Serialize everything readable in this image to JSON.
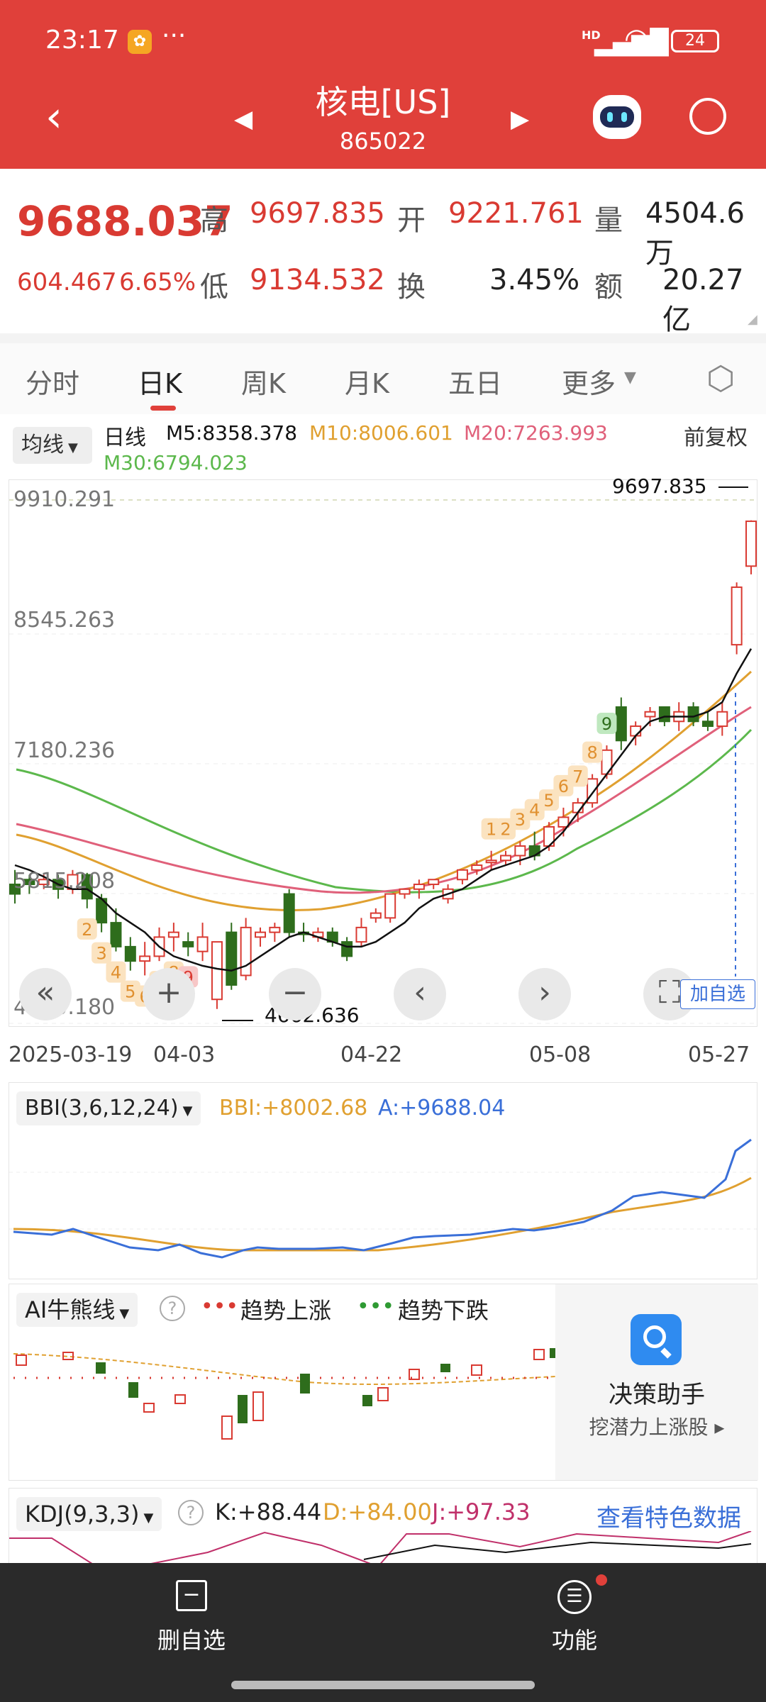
{
  "status_bar": {
    "time": "23:17",
    "battery": "24",
    "network": "HD"
  },
  "header": {
    "title": "核电[US]",
    "code": "865022"
  },
  "quote": {
    "price": "9688.037",
    "change": "604.467",
    "change_pct": "6.65%",
    "high_label": "高",
    "high": "9697.835",
    "open_label": "开",
    "open": "9221.761",
    "volume_label": "量",
    "volume": "4504.6万",
    "low_label": "低",
    "low": "9134.532",
    "turnover_label": "换",
    "turnover": "3.45%",
    "amount_label": "额",
    "amount": "20.27亿"
  },
  "tabs": [
    "分时",
    "日K",
    "周K",
    "月K",
    "五日",
    "更多"
  ],
  "ma_bar": {
    "selector": "均线",
    "period": "日线",
    "m5": "M5:8358.378",
    "m10": "M10:8006.601",
    "m20": "M20:7263.993",
    "m30": "M30:6794.023",
    "adjust": "前复权"
  },
  "main_chart": {
    "y_labels": [
      "9910.291",
      "8545.263",
      "7180.236",
      "5815.208",
      "4450.180"
    ],
    "high_marker": "9697.835",
    "low_marker": "4662.636",
    "x_labels": [
      "2025-03-19",
      "04-03",
      "04-22",
      "05-08",
      "05-27"
    ],
    "add_label": "加自选",
    "td_up_counts": [
      "1",
      "2",
      "3",
      "4",
      "5",
      "6",
      "7",
      "8",
      "9"
    ],
    "td_down_counts": [
      "2",
      "3",
      "4",
      "5",
      "6",
      "7",
      "8",
      "9"
    ]
  },
  "bbi": {
    "label": "BBI(3,6,12,24)",
    "bbi_value": "BBI:+8002.68",
    "a_value": "A:+9688.04"
  },
  "ai": {
    "label": "AI牛熊线",
    "legend_up": "趋势上涨",
    "legend_down": "趋势下跌",
    "assistant_title": "决策助手",
    "assistant_sub": "挖潜力上涨股"
  },
  "kdj": {
    "label": "KDJ(9,3,3)",
    "k": "K:+88.44",
    "d": "D:+84.00",
    "j": "J:+97.33",
    "link": "查看特色数据"
  },
  "bottom_nav": {
    "remove": "删自选",
    "function": "功能"
  },
  "chart_data": {
    "type": "candlestick",
    "ylim": [
      4450.18,
      9910.291
    ],
    "ohlc": [
      [
        5900,
        6050,
        5700,
        5800
      ],
      [
        5950,
        6000,
        5800,
        5900
      ],
      [
        5900,
        6000,
        5850,
        5950
      ],
      [
        5950,
        6000,
        5750,
        5850
      ],
      [
        5850,
        6050,
        5800,
        6000
      ],
      [
        6000,
        6020,
        5650,
        5750
      ],
      [
        5750,
        5800,
        5400,
        5500
      ],
      [
        5500,
        5650,
        5200,
        5250
      ],
      [
        5250,
        5350,
        5000,
        5100
      ],
      [
        5100,
        5300,
        4950,
        5150
      ],
      [
        5150,
        5450,
        5100,
        5350
      ],
      [
        5350,
        5500,
        5200,
        5400
      ],
      [
        5300,
        5400,
        5150,
        5250
      ],
      [
        5200,
        5500,
        5100,
        5350
      ],
      [
        4700,
        5300,
        4600,
        5300
      ],
      [
        5400,
        5500,
        4800,
        4850
      ],
      [
        4950,
        5550,
        4900,
        5450
      ],
      [
        5350,
        5450,
        5250,
        5400
      ],
      [
        5400,
        5500,
        5300,
        5450
      ],
      [
        5800,
        5850,
        5350,
        5400
      ],
      [
        5400,
        5500,
        5300,
        5380
      ],
      [
        5350,
        5450,
        5300,
        5400
      ],
      [
        5400,
        5450,
        5250,
        5300
      ],
      [
        5300,
        5350,
        5100,
        5150
      ],
      [
        5300,
        5550,
        5250,
        5450
      ],
      [
        5550,
        5650,
        5500,
        5600
      ],
      [
        5550,
        5800,
        5500,
        5800
      ],
      [
        5800,
        5850,
        5750,
        5850
      ],
      [
        5850,
        5950,
        5750,
        5900
      ],
      [
        5900,
        5950,
        5850,
        5950
      ],
      [
        5750,
        5900,
        5700,
        5850
      ],
      [
        5950,
        6050,
        5900,
        6050
      ],
      [
        6050,
        6150,
        6000,
        6100
      ],
      [
        6150,
        6250,
        6050,
        6150
      ],
      [
        6150,
        6250,
        6100,
        6200
      ],
      [
        6200,
        6350,
        6100,
        6300
      ],
      [
        6300,
        6450,
        6150,
        6200
      ],
      [
        6300,
        6550,
        6250,
        6500
      ],
      [
        6500,
        6700,
        6400,
        6600
      ],
      [
        6650,
        6800,
        6550,
        6750
      ],
      [
        6750,
        7050,
        6700,
        7000
      ],
      [
        7050,
        7350,
        7000,
        7300
      ],
      [
        7750,
        7850,
        7300,
        7400
      ],
      [
        7450,
        7600,
        7350,
        7550
      ],
      [
        7650,
        7750,
        7550,
        7700
      ],
      [
        7750,
        7700,
        7550,
        7600
      ],
      [
        7600,
        7800,
        7500,
        7700
      ],
      [
        7750,
        7800,
        7550,
        7600
      ],
      [
        7600,
        7700,
        7500,
        7550
      ],
      [
        7550,
        7800,
        7450,
        7700
      ],
      [
        8400,
        9050,
        8300,
        9000
      ],
      [
        9220,
        9698,
        9134,
        9688
      ]
    ],
    "ma5": [
      6100,
      6050,
      5980,
      5900,
      5850,
      5850,
      5750,
      5600,
      5500,
      5400,
      5250,
      5150,
      5100,
      5050,
      5020,
      5000,
      5050,
      5150,
      5250,
      5350,
      5400,
      5350,
      5300,
      5250,
      5250,
      5300,
      5400,
      5500,
      5650,
      5750,
      5800,
      5850,
      5950,
      6050,
      6100,
      6150,
      6200,
      6300,
      6450,
      6650,
      6850,
      7050,
      7250,
      7450,
      7600,
      7650,
      7650,
      7650,
      7700,
      7800,
      8100,
      8358
    ]
  }
}
